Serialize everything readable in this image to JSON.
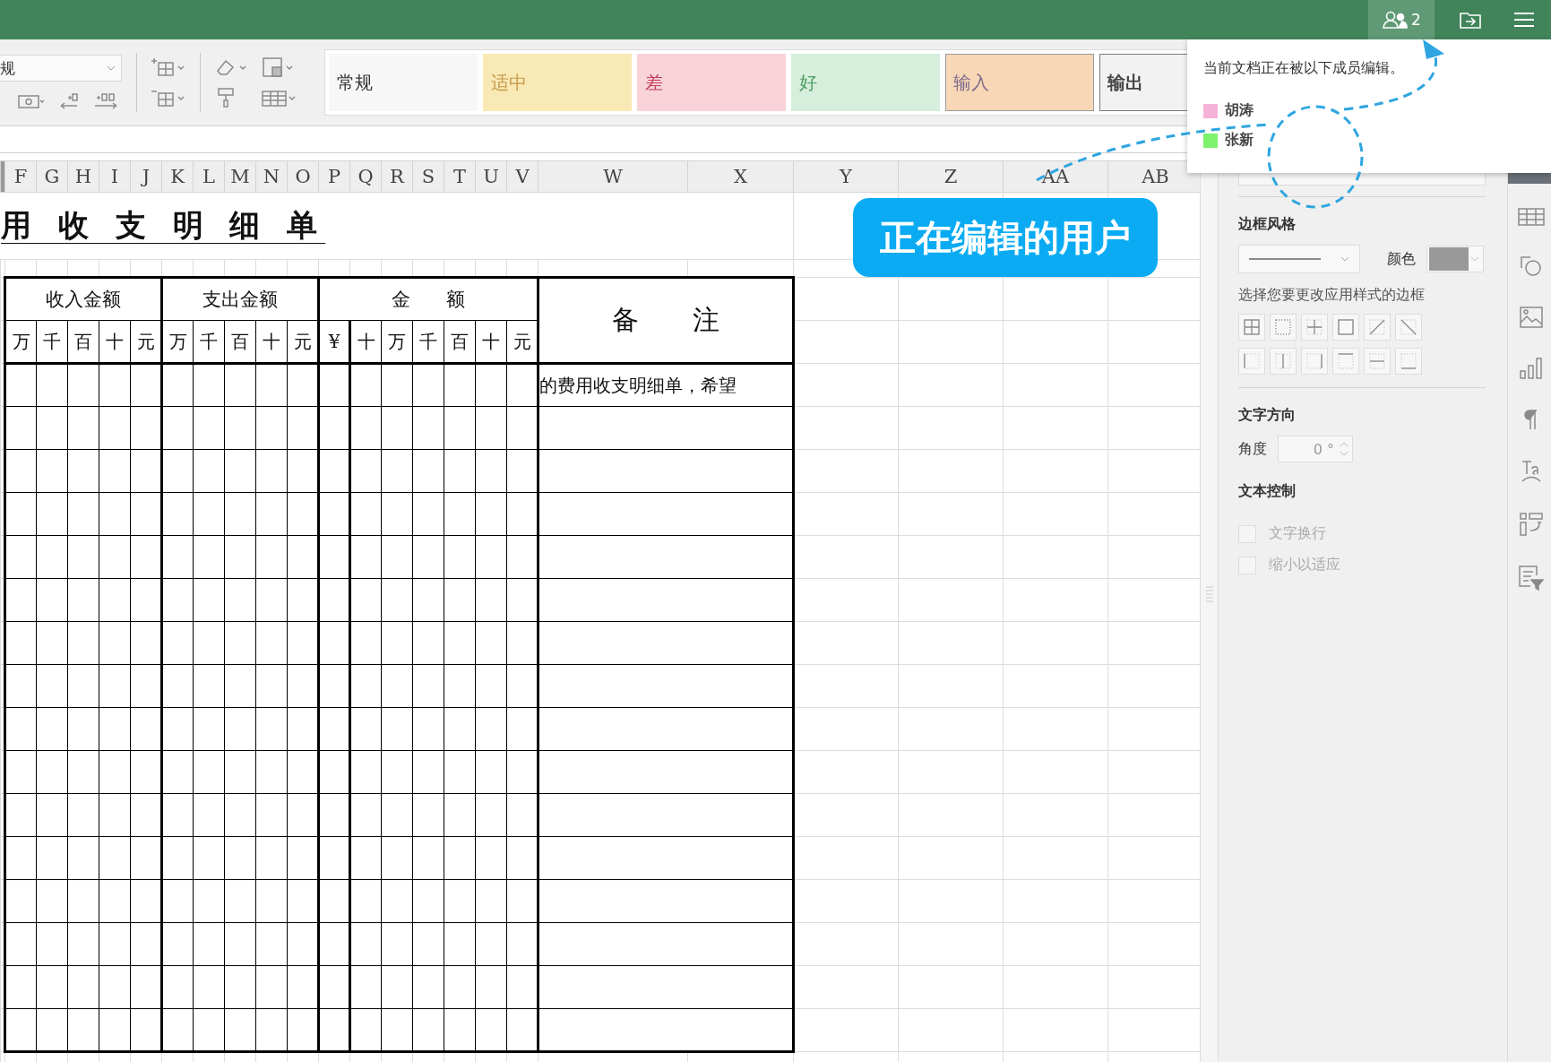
{
  "top_bar": {
    "collaborators_button": {
      "count": "2",
      "active": true
    }
  },
  "toolbar": {
    "format_dropdown": {
      "value": "规"
    },
    "styles": [
      {
        "label": "常规",
        "kind": "normal"
      },
      {
        "label": "适中",
        "kind": "neutral"
      },
      {
        "label": "差",
        "kind": "bad"
      },
      {
        "label": "好",
        "kind": "good"
      },
      {
        "label": "输入",
        "kind": "input"
      },
      {
        "label": "输出",
        "kind": "output"
      }
    ]
  },
  "sheet": {
    "columns": [
      "F",
      "G",
      "H",
      "I",
      "J",
      "K",
      "L",
      "M",
      "N",
      "O",
      "P",
      "Q",
      "R",
      "S",
      "T",
      "U",
      "V",
      "W",
      "X",
      "Y",
      "Z",
      "AA",
      "AB"
    ],
    "title": "用 收 支 明 细 单",
    "group_headers": [
      "收入金额",
      "支出金额",
      "金 额"
    ],
    "remark_header": "备 注",
    "digit_headers": [
      "万",
      "千",
      "百",
      "十",
      "元",
      "万",
      "千",
      "百",
      "十",
      "元",
      "¥",
      "十",
      "万",
      "千",
      "百",
      "十",
      "元"
    ],
    "remarks": [
      "的费用收支明细单，希望"
    ]
  },
  "collaborators_popup": {
    "message": "当前文档正在被以下成员编辑。",
    "users": [
      {
        "name": "胡涛",
        "color": "#f5b2d8"
      },
      {
        "name": "张新",
        "color": "#7ef26e"
      }
    ]
  },
  "callout": {
    "text": "正在编辑的用户"
  },
  "format_panel": {
    "border_title": "边框风格",
    "color_label": "颜色",
    "border_hint": "选择您要更改应用样式的边框",
    "direction_title": "文字方向",
    "angle_label": "角度",
    "angle_value": "0 °",
    "control_title": "文本控制",
    "options": [
      {
        "label": "文字换行",
        "checked": false,
        "disabled": true
      },
      {
        "label": "缩小以适应",
        "checked": false,
        "disabled": true
      }
    ]
  }
}
